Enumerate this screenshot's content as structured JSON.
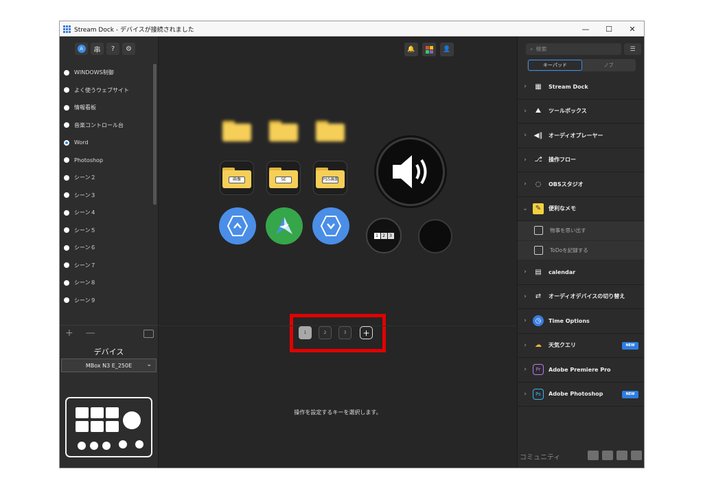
{
  "window": {
    "title": "Stream Dock - デバイスが接続されました",
    "controls": [
      "—",
      "☐",
      "✕"
    ]
  },
  "left": {
    "tools": [
      "A",
      "串",
      "?",
      "⚙"
    ],
    "profiles": [
      {
        "label": "WINDOWS制御",
        "selected": false
      },
      {
        "label": "よく使うウェブサイト",
        "selected": false
      },
      {
        "label": "情報看板",
        "selected": false
      },
      {
        "label": "音楽コントロール台",
        "selected": false
      },
      {
        "label": "Word",
        "selected": true
      },
      {
        "label": "Photoshop",
        "selected": false
      },
      {
        "label": "シーン２",
        "selected": false
      },
      {
        "label": "シーン３",
        "selected": false
      },
      {
        "label": "シーン４",
        "selected": false
      },
      {
        "label": "シーン５",
        "selected": false
      },
      {
        "label": "シーン６",
        "selected": false
      },
      {
        "label": "シーン７",
        "selected": false
      },
      {
        "label": "シーン８",
        "selected": false
      },
      {
        "label": "シーン９",
        "selected": false
      }
    ],
    "add": "+",
    "remove": "—",
    "device_title": "デバイス",
    "device_select": "MBox N3 E_250E"
  },
  "center": {
    "folder_labels": [
      "画像",
      "SE",
      "PS5画面"
    ],
    "pages": [
      "1",
      "2",
      "3"
    ],
    "add_page": "+",
    "selected_page": "1",
    "status": "操作を設定するキーを選択します。",
    "dial_keys": [
      "1",
      "2",
      "3"
    ]
  },
  "right": {
    "search_placeholder": "検索",
    "tabs": [
      "キーパッド",
      "ノブ"
    ],
    "active_tab": "キーパッド",
    "categories": [
      {
        "label": "Stream Dock",
        "icon": "grid-icon",
        "expanded": false
      },
      {
        "label": "ツールボックス",
        "icon": "toolbox-icon",
        "expanded": false
      },
      {
        "label": "オーディオプレーヤー",
        "icon": "audio-player-icon",
        "expanded": false
      },
      {
        "label": "操作フロー",
        "icon": "flow-icon",
        "expanded": false
      },
      {
        "label": "OBSスタジオ",
        "icon": "obs-icon",
        "expanded": false
      },
      {
        "label": "便利なメモ",
        "icon": "memo-icon",
        "expanded": true
      },
      {
        "label": "calendar",
        "icon": "calendar-icon",
        "expanded": false
      },
      {
        "label": "オーディオデバイスの切り替え",
        "icon": "audio-device-icon",
        "expanded": false
      },
      {
        "label": "Time Options",
        "icon": "clock-icon",
        "expanded": false
      },
      {
        "label": "天気クエリ",
        "icon": "weather-icon",
        "expanded": false,
        "badge": "NEW"
      },
      {
        "label": "Adobe Premiere Pro",
        "icon": "premiere-icon",
        "expanded": false
      },
      {
        "label": "Adobe Photoshop",
        "icon": "photoshop-icon",
        "expanded": false,
        "badge": "NEW"
      }
    ],
    "memo_items": [
      "物事を思い出す",
      "ToDoを記録する"
    ],
    "community": "コミュニティ",
    "social": [
      "discord-icon",
      "facebook-icon",
      "chat-icon",
      "mail-icon"
    ]
  },
  "colors": {
    "accent": "#3a8eea",
    "highlight": "#e20000",
    "panel": "#262626"
  }
}
